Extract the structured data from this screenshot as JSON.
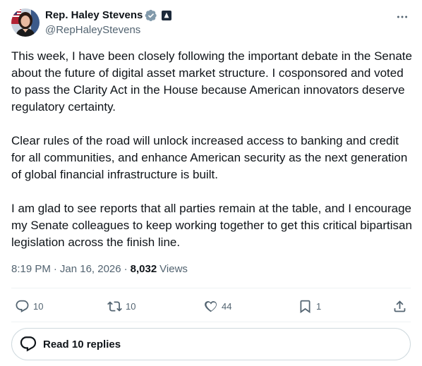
{
  "author": {
    "display_name": "Rep. Haley Stevens",
    "handle": "@RepHaleyStevens",
    "avatar_icon": "profile-photo",
    "verified_icon": "verified-badge-icon",
    "affiliation_icon": "government-affiliation-icon"
  },
  "post": {
    "paragraphs": [
      "This week, I have been closely following the important debate in the Senate about the future of digital asset market structure. I cosponsored and voted to pass the Clarity Act in the House because American innovators deserve regulatory certainty.",
      "Clear rules of the road will unlock increased access to banking and credit for all communities, and enhance American security as the next generation of global financial infrastructure is built.",
      "I am glad to see reports that all parties remain at the table, and I encourage my Senate colleagues to keep working together to get this critical bipartisan legislation across the finish line."
    ],
    "time": "8:19 PM",
    "date": "Jan 16, 2026",
    "views_count": "8,032",
    "views_label": "Views"
  },
  "actions": {
    "reply_count": "10",
    "repost_count": "10",
    "like_count": "44",
    "bookmark_count": "1"
  },
  "replies_button": {
    "label": "Read 10 replies"
  },
  "colors": {
    "text": "#0f1419",
    "muted": "#536471",
    "verified": "#829aab",
    "border": "#cfd9de"
  }
}
